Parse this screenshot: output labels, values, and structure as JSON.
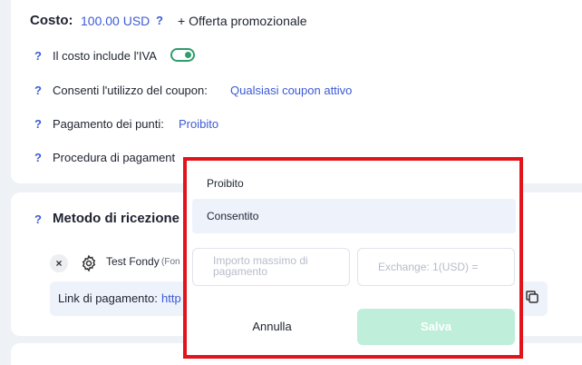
{
  "cost": {
    "label": "Costo:",
    "value": "100.00 USD",
    "help": "?",
    "promo": "+ Offerta promozionale"
  },
  "settings": [
    {
      "help": "?",
      "label": "Il costo include l'IVA",
      "toggle_on": true
    },
    {
      "help": "?",
      "label": "Consenti l'utilizzo del coupon:",
      "value": "Qualsiasi coupon attivo"
    },
    {
      "help": "?",
      "label": "Pagamento dei punti:",
      "value": "Proibito"
    },
    {
      "help": "?",
      "label": "Procedura di pagament"
    }
  ],
  "receive_method": {
    "help": "?",
    "title": "Metodo di ricezione",
    "provider_name": "Test Fondy",
    "provider_sub": "(Fon",
    "remove_icon": "×",
    "payment_link_label": "Link di pagamento:",
    "payment_link_value": "http"
  },
  "popup": {
    "options": [
      "Proibito",
      "Consentito"
    ],
    "selected": "Consentito",
    "max_amount_placeholder": "Importo massimo di pagamento",
    "exchange_placeholder": "Exchange: 1(USD) =",
    "cancel_label": "Annulla",
    "save_label": "Salva"
  },
  "colors": {
    "accent": "#3c5bd6",
    "toggle": "#2f9d6c",
    "highlight_border": "#e0141a",
    "save_disabled": "#bfeedb"
  },
  "icons": {
    "gear": "gear-icon",
    "copy": "copy-icon",
    "remove": "close-icon"
  }
}
